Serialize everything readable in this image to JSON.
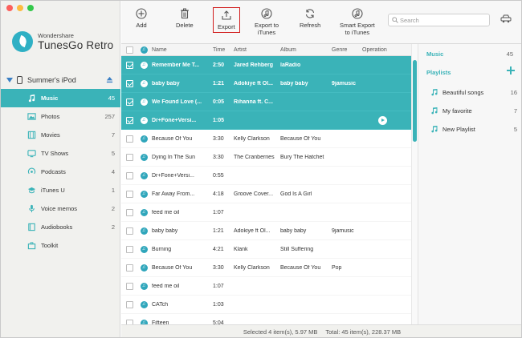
{
  "window": {
    "traffic_colors": [
      "#fc605c",
      "#fdbc40",
      "#34c84a"
    ]
  },
  "brand": {
    "company": "Wondershare",
    "product": "TunesGo Retro"
  },
  "device": {
    "name": "Summer's iPod"
  },
  "sidebar": {
    "items": [
      {
        "label": "Music",
        "count": "45",
        "icon": "music-note-icon",
        "active": true
      },
      {
        "label": "Photos",
        "count": "257",
        "icon": "photos-icon"
      },
      {
        "label": "Movies",
        "count": "7",
        "icon": "movies-icon"
      },
      {
        "label": "TV Shows",
        "count": "5",
        "icon": "tv-icon"
      },
      {
        "label": "Podcasts",
        "count": "4",
        "icon": "podcast-icon"
      },
      {
        "label": "iTunes U",
        "count": "1",
        "icon": "graduation-icon"
      },
      {
        "label": "Voice memos",
        "count": "2",
        "icon": "microphone-icon"
      },
      {
        "label": "Audiobooks",
        "count": "2",
        "icon": "book-icon"
      },
      {
        "label": "Toolkit",
        "count": "",
        "icon": "toolkit-icon"
      }
    ]
  },
  "toolbar": {
    "add": "Add",
    "delete": "Delete",
    "export": "Export",
    "export_itunes_1": "Export to",
    "export_itunes_2": "iTunes",
    "refresh": "Refresh",
    "smart_export_1": "Smart Export",
    "smart_export_2": "to iTunes",
    "search_placeholder": "Search",
    "accent": "#3ab3b8",
    "highlight": "#d11c1c"
  },
  "table": {
    "columns": {
      "name": "Name",
      "time": "Time",
      "artist": "Artist",
      "album": "Album",
      "genre": "Genre",
      "operation": "Operation"
    },
    "rows": [
      {
        "name": "Remember Me T...",
        "time": "2:50",
        "artist": "Jared Rehberg",
        "album": "laRadio",
        "genre": "",
        "selected": true
      },
      {
        "name": "baby baby",
        "time": "1:21",
        "artist": "Adokiye ft Ol...",
        "album": "baby baby",
        "genre": "9jamusic",
        "selected": true
      },
      {
        "name": "We Found Love (...",
        "time": "0:05",
        "artist": "Rihanna ft. C...",
        "album": "",
        "genre": "",
        "selected": true
      },
      {
        "name": "Dr+Fone+Versi...",
        "time": "1:05",
        "artist": "",
        "album": "",
        "genre": "",
        "selected": true,
        "play": true
      },
      {
        "name": "Because Of You",
        "time": "3:30",
        "artist": "Kelly Clarkson",
        "album": "Because Of You",
        "genre": ""
      },
      {
        "name": "Dying In The Sun",
        "time": "3:30",
        "artist": "The Cranberries",
        "album": "Bury The Hatchet",
        "genre": ""
      },
      {
        "name": "Dr+Fone+Versi...",
        "time": "0:55",
        "artist": "",
        "album": "",
        "genre": ""
      },
      {
        "name": "Far Away From...",
        "time": "4:18",
        "artist": "Groove Cover...",
        "album": "God Is A Girl",
        "genre": ""
      },
      {
        "name": "feed me oil",
        "time": "1:07",
        "artist": "",
        "album": "",
        "genre": ""
      },
      {
        "name": "baby baby",
        "time": "1:21",
        "artist": "Adokiye ft Ol...",
        "album": "baby baby",
        "genre": "9jamusic"
      },
      {
        "name": "Burning",
        "time": "4:21",
        "artist": "Klank",
        "album": "Still Suffering",
        "genre": ""
      },
      {
        "name": "Because Of You",
        "time": "3:30",
        "artist": "Kelly Clarkson",
        "album": "Because Of You",
        "genre": "Pop"
      },
      {
        "name": "feed me oil",
        "time": "1:07",
        "artist": "",
        "album": "",
        "genre": ""
      },
      {
        "name": "CATch",
        "time": "1:03",
        "artist": "",
        "album": "",
        "genre": ""
      },
      {
        "name": "Fifteen",
        "time": "5:04",
        "artist": "",
        "album": "",
        "genre": ""
      }
    ]
  },
  "right_panel": {
    "music_label": "Music",
    "music_count": "45",
    "playlists_label": "Playlists",
    "playlists": [
      {
        "name": "Beautiful songs",
        "count": "16"
      },
      {
        "name": "My favorite",
        "count": "7"
      },
      {
        "name": "New Playlist",
        "count": "5"
      }
    ]
  },
  "status": {
    "selected": "Selected 4 item(s), 5.97 MB",
    "total": "Total: 45 item(s), 228.37 MB"
  }
}
